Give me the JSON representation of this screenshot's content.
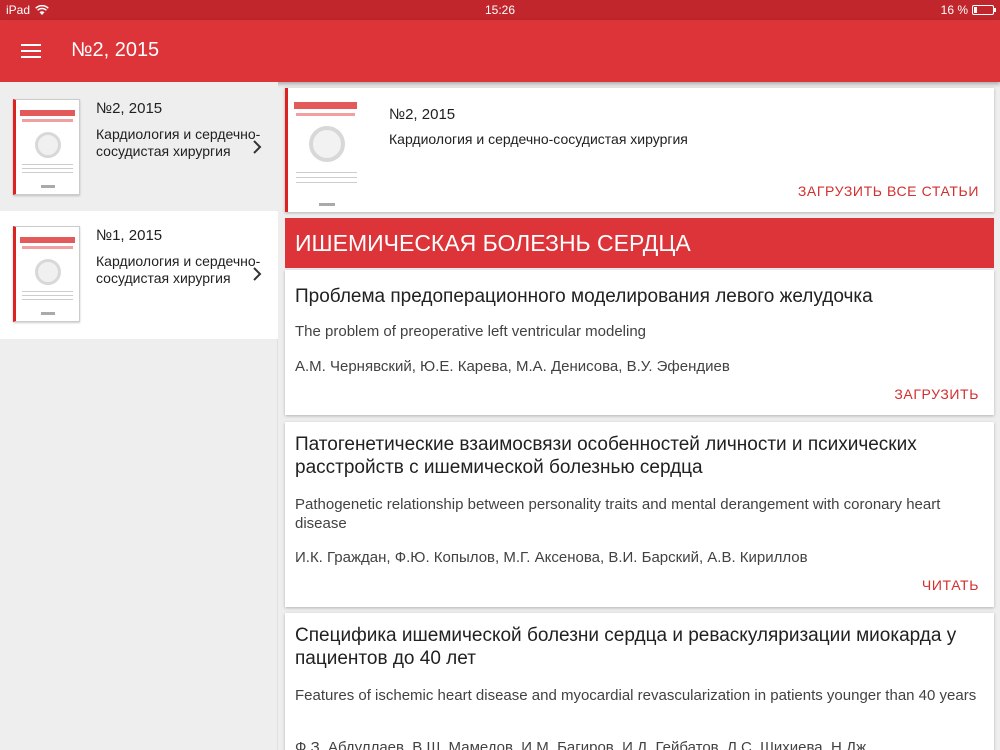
{
  "status_bar": {
    "device": "iPad",
    "time": "15:26",
    "battery": "16 %",
    "battery_level": 0.16
  },
  "app_bar": {
    "title": "№2, 2015"
  },
  "sidebar": {
    "issues": [
      {
        "number": "№2, 2015",
        "title": "Кардиология и сердечно-сосудистая хирургия"
      },
      {
        "number": "№1, 2015",
        "title": "Кардиология и сердечно-сосудистая хирургия"
      }
    ]
  },
  "issue_header": {
    "number": "№2, 2015",
    "title": "Кардиология и сердечно-сосудистая хирургия",
    "download_all_label": "ЗАГРУЗИТЬ ВСЕ СТАТЬИ"
  },
  "section": {
    "title": "ИШЕМИЧЕСКАЯ БОЛЕЗНЬ СЕРДЦА"
  },
  "articles": [
    {
      "title": "Проблема предоперационного моделирования левого желудочка",
      "title_en": "The problem of preoperative left ventricular modeling",
      "authors": "А.М. Чернявский, Ю.Е. Карева, М.А. Денисова, В.У. Эфендиев",
      "action": "ЗАГРУЗИТЬ"
    },
    {
      "title": "Патогенетические взаимосвязи особенностей личности и психических расстройств с ишемической болезнью сердца",
      "title_en": "Pathogenetic relationship between personality traits and mental derangement with coronary heart disease",
      "authors": "И.К. Граждан, Ф.Ю. Копылов, М.Г. Аксенова, В.И. Барский, А.В. Кириллов",
      "action": "ЧИТАТЬ"
    },
    {
      "title": "Специфика ишемической болезни сердца и реваскуляризации миокарда у пациентов до 40 лет",
      "title_en": "Features of ischemic heart disease and myocardial revascularization in patients younger than 40 years",
      "authors": "Ф.З. Абдуллаев, В.Ш. Мамедов, И.М. Багиров, И.Д. Гейбатов, Л.С. Шихиева, Н.Дж"
    }
  ],
  "colors": {
    "primary": "#dd3439",
    "status_bar": "#c0262b",
    "accent_text": "#d32f2f",
    "background": "#eeeeee"
  },
  "icons": [
    "wifi-icon",
    "menu-icon",
    "chevron-right-icon",
    "journal-cover-image"
  ]
}
